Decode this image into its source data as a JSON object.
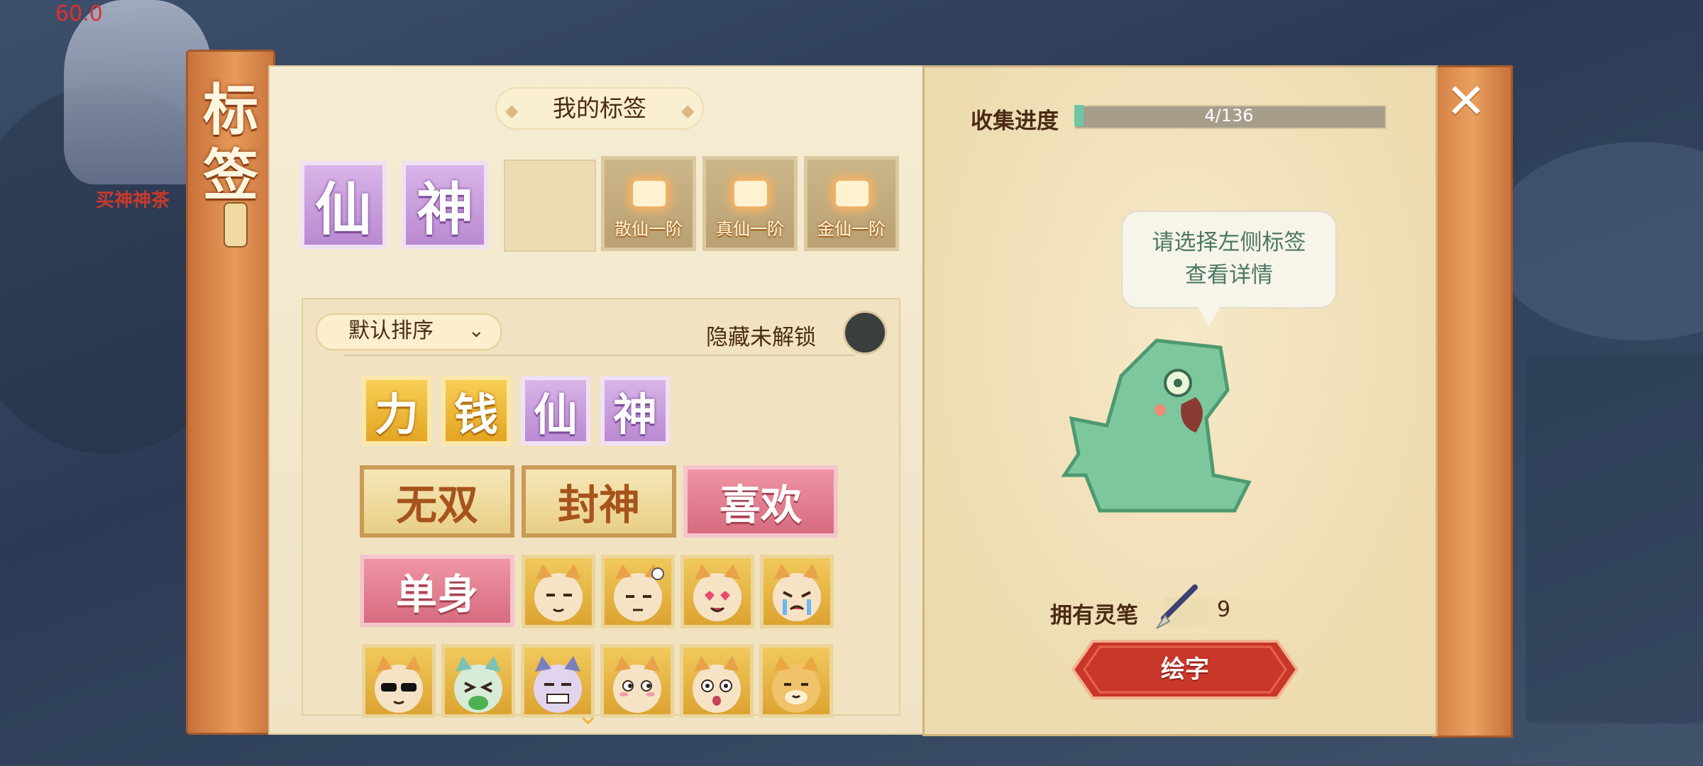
{
  "hud": {
    "fps": "60.0",
    "npc_name": "买神神茶"
  },
  "book": {
    "spine_title": "标签",
    "close_icon": "close-x-icon"
  },
  "my_tags": {
    "header": "我的标签",
    "equipped": [
      {
        "char": "仙",
        "style": "purple"
      },
      {
        "char": "神",
        "style": "purple"
      }
    ],
    "locked_slots": [
      "散仙一阶",
      "真仙一阶",
      "金仙一阶"
    ]
  },
  "tag_list": {
    "sort_label": "默认排序",
    "hide_locked_label": "隐藏未解锁",
    "single_tags": [
      {
        "char": "力",
        "style": "gold"
      },
      {
        "char": "钱",
        "style": "gold"
      },
      {
        "char": "仙",
        "style": "purple"
      },
      {
        "char": "神",
        "style": "purple"
      }
    ],
    "word_tags": [
      {
        "text": "无双",
        "style": "cream"
      },
      {
        "text": "封神",
        "style": "cream"
      },
      {
        "text": "喜欢",
        "style": "pink"
      },
      {
        "text": "单身",
        "style": "pink"
      }
    ],
    "cat_emotes_row1": [
      "cat-smirk-icon",
      "cat-thinking-icon",
      "cat-heart-eyes-icon",
      "cat-crying-icon"
    ],
    "cat_emotes_row2": [
      "cat-sunglasses-icon",
      "cat-vomit-icon",
      "cat-gritted-icon",
      "cat-side-eye-icon",
      "cat-shocked-icon",
      "cat-doge-icon"
    ]
  },
  "detail": {
    "progress_label": "收集进度",
    "progress_text": "4/136",
    "progress_fraction": 0.029,
    "hint_line1": "请选择左侧标签",
    "hint_line2": "查看详情",
    "brush_label": "拥有灵笔",
    "brush_count": "9",
    "draw_button": "绘字"
  },
  "colors": {
    "accent_green": "#6fc6a4",
    "button_red": "#c9362a",
    "text_brown": "#4a2a15"
  }
}
